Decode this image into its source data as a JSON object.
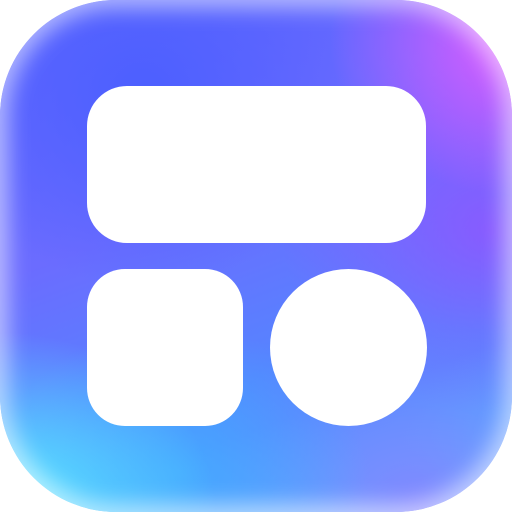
{
  "icon": {
    "name": "widget-layout-app-icon",
    "colors": {
      "top_right": "#e65aff",
      "top_left": "#4b5fff",
      "bottom_left": "#5af0ff",
      "bottom_right": "#8c78ff",
      "shapes": "#ffffff"
    },
    "shapes": [
      "wide-rounded-rectangle",
      "rounded-square",
      "circle"
    ]
  }
}
